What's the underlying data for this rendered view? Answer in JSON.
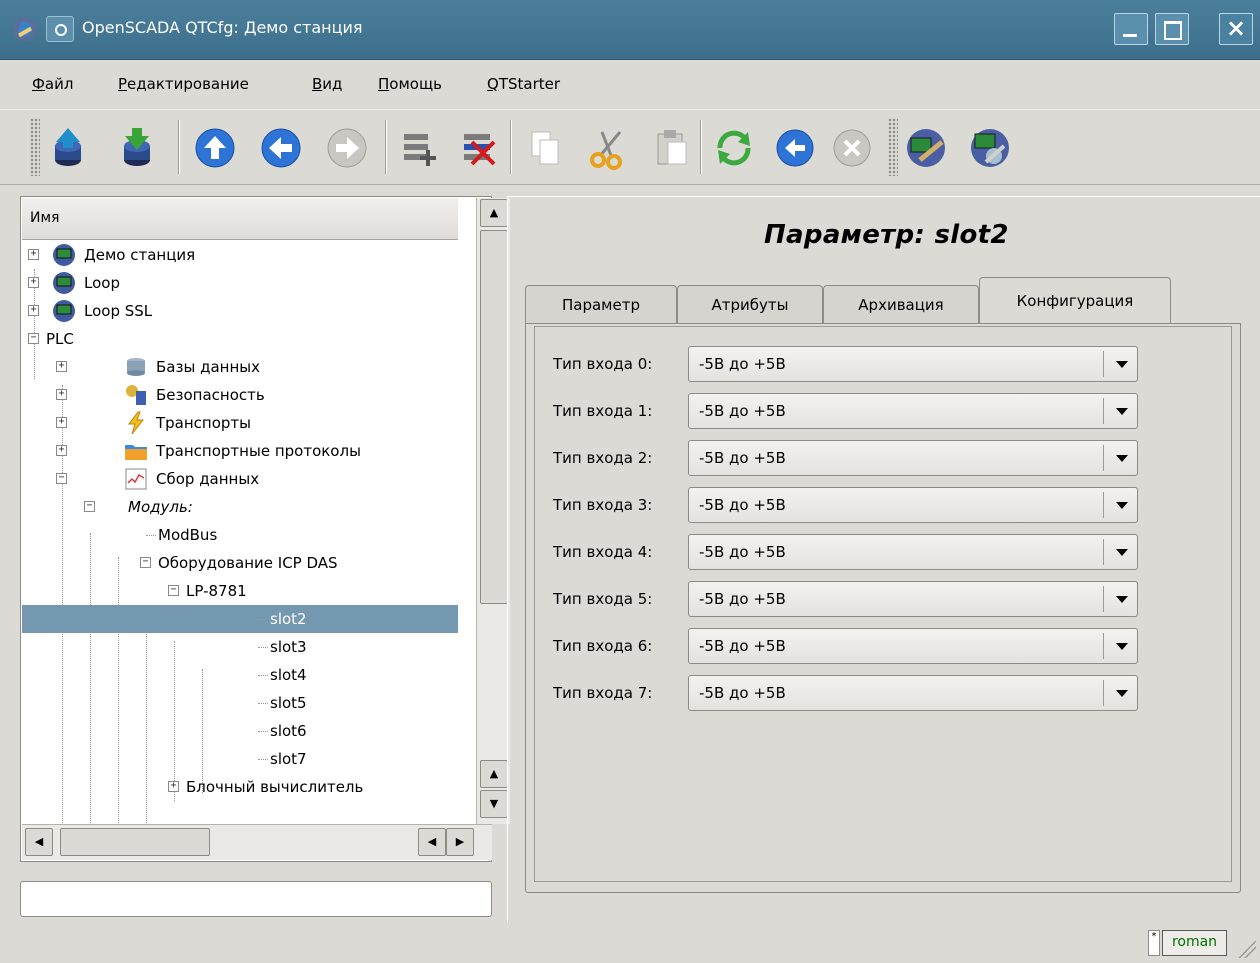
{
  "window": {
    "title": "OpenSCADA QTCfg: Демо станция"
  },
  "menu": [
    {
      "label": "Файл"
    },
    {
      "label": "Редактирование"
    },
    {
      "label": "Вид"
    },
    {
      "label": "Помощь"
    },
    {
      "label": "QTStarter"
    }
  ],
  "toolbar": {
    "buttons": [
      {
        "icon": "db-load-icon"
      },
      {
        "icon": "db-save-icon"
      },
      {
        "icon": "go-up-icon"
      },
      {
        "icon": "go-back-icon"
      },
      {
        "icon": "go-forward-icon"
      },
      {
        "icon": "add-item-icon"
      },
      {
        "icon": "delete-item-icon"
      },
      {
        "icon": "copy-icon"
      },
      {
        "icon": "cut-icon"
      },
      {
        "icon": "paste-icon"
      },
      {
        "icon": "refresh-icon"
      },
      {
        "icon": "start-icon"
      },
      {
        "icon": "stop-icon"
      },
      {
        "icon": "module-info-icon"
      },
      {
        "icon": "about-icon"
      }
    ]
  },
  "tree": {
    "header": "Имя",
    "items": [
      {
        "label": "Демо станция"
      },
      {
        "label": "Loop"
      },
      {
        "label": "Loop SSL"
      },
      {
        "label": "PLC"
      },
      {
        "label": "Базы данных"
      },
      {
        "label": "Безопасность"
      },
      {
        "label": "Транспорты"
      },
      {
        "label": "Транспортные протоколы"
      },
      {
        "label": "Сбор данных"
      },
      {
        "label": "Модуль:"
      },
      {
        "label": "ModBus"
      },
      {
        "label": "Оборудование ICP DAS"
      },
      {
        "label": "LP-8781"
      },
      {
        "label": "slot2"
      },
      {
        "label": "slot3"
      },
      {
        "label": "slot4"
      },
      {
        "label": "slot5"
      },
      {
        "label": "slot6"
      },
      {
        "label": "slot7"
      },
      {
        "label": "Блочный вычислитель"
      }
    ]
  },
  "main": {
    "title": "Параметр: slot2",
    "tabs": [
      {
        "label": "Параметр"
      },
      {
        "label": "Атрибуты"
      },
      {
        "label": "Архивация"
      },
      {
        "label": "Конфигурация"
      }
    ],
    "fields": [
      {
        "label": "Тип входа 0:",
        "value": "-5В до +5В"
      },
      {
        "label": "Тип входа 1:",
        "value": "-5В до +5В"
      },
      {
        "label": "Тип входа 2:",
        "value": "-5В до +5В"
      },
      {
        "label": "Тип входа 3:",
        "value": "-5В до +5В"
      },
      {
        "label": "Тип входа 4:",
        "value": "-5В до +5В"
      },
      {
        "label": "Тип входа 5:",
        "value": "-5В до +5В"
      },
      {
        "label": "Тип входа 6:",
        "value": "-5В до +5В"
      },
      {
        "label": "Тип входа 7:",
        "value": "-5В до +5В"
      }
    ]
  },
  "statusbar": {
    "user": "roman"
  },
  "colors": {
    "titlebar": "#3d6f8c",
    "selection": "#7398b0",
    "background": "#dcdad5",
    "user_text": "#007000"
  }
}
